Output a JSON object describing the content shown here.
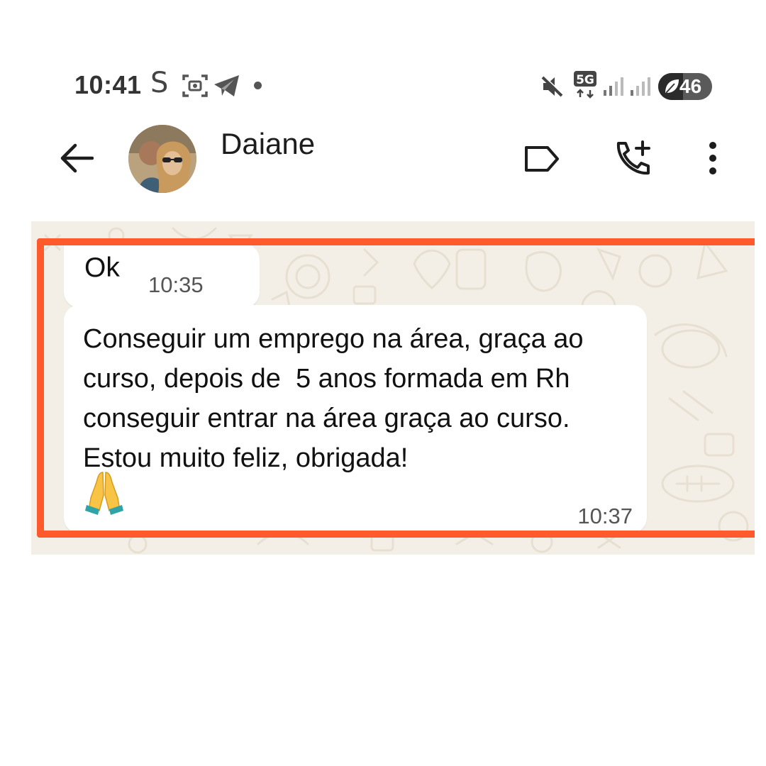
{
  "status_bar": {
    "time": "10:41",
    "app_icon_letter": "S",
    "network": "5G",
    "battery_level": "46",
    "battery_fraction": 0.46
  },
  "header": {
    "contact_name": "Daiane"
  },
  "messages": [
    {
      "text": "Ok",
      "time": "10:35"
    },
    {
      "text": "Conseguir um emprego na área, graça ao curso, depois de  5 anos formada em Rh conseguir entrar na área graça ao curso. Estou muito feliz, obrigada!",
      "emoji": "praying-hands",
      "time": "10:37"
    }
  ],
  "colors": {
    "highlight_border": "#ff5a2c",
    "chat_background": "#f4efe6",
    "bubble": "#ffffff"
  }
}
